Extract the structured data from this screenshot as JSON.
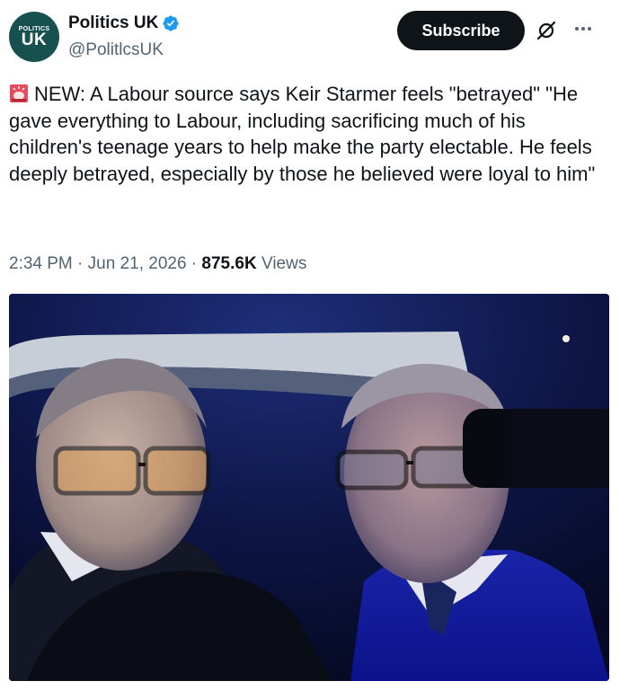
{
  "account": {
    "display_name": "Politics UK",
    "handle": "@PolitlcsUK",
    "avatar_small_text": "POLITICS",
    "avatar_big_text": "UK"
  },
  "actions": {
    "subscribe_label": "Subscribe",
    "grok_icon": "grok-slash-circle-icon",
    "more_icon": "more-dots-icon"
  },
  "tweet": {
    "text": "NEW: A Labour source says Keir Starmer feels \"betrayed\" \"He gave everything to Labour, including sacrificing much of his children's teenage years to help make the party electable. He feels deeply betrayed, especially by those he believed were loyal to him\"",
    "emoji_icon": "rotating-light-siren-icon"
  },
  "meta": {
    "time": "2:34 PM",
    "separator": " · ",
    "date": "Jun 21, 2026",
    "views_count": "875.6K",
    "views_label": "Views"
  },
  "colors": {
    "primary_text": "#0f1419",
    "secondary_text": "#536471",
    "verified_blue": "#1d9bf0",
    "subscribe_bg": "#0f1419",
    "avatar_bg": "#17514f"
  }
}
